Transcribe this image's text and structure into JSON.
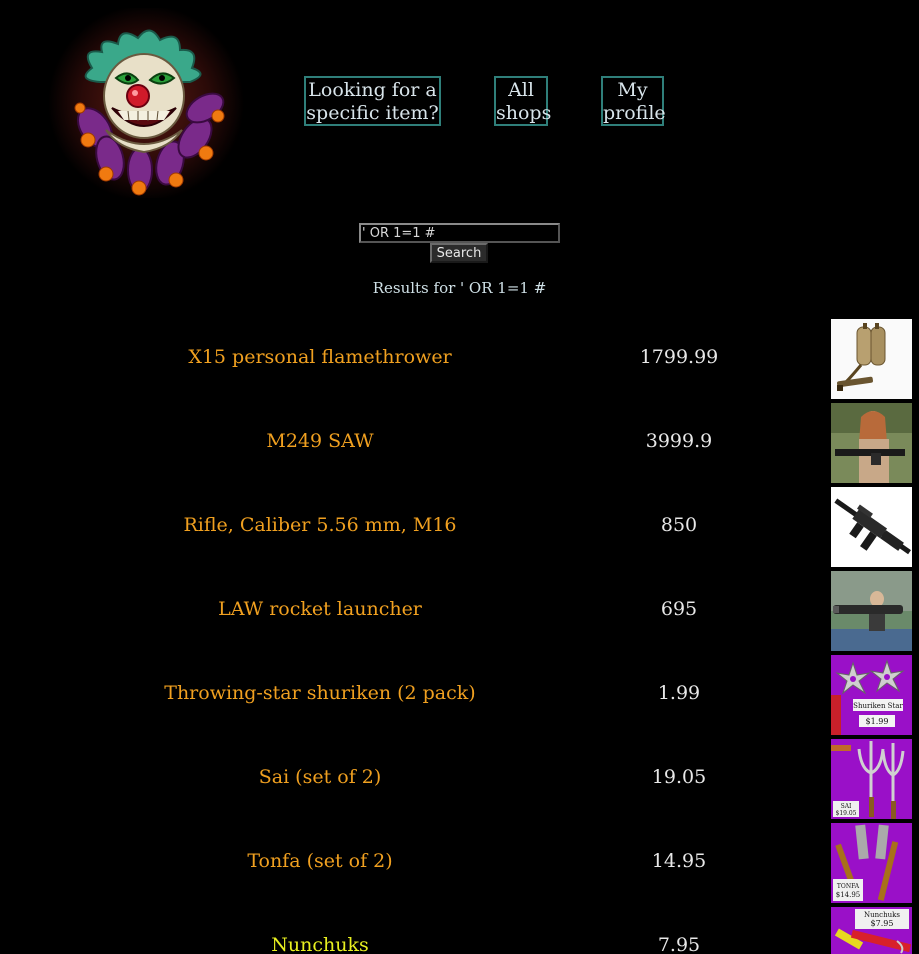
{
  "nav": {
    "find_item_line1": "Looking for a",
    "find_item_line2": "specific item?",
    "all_shops_line1": "All",
    "all_shops_line2": "shops",
    "profile_line1": "My",
    "profile_line2": "profile"
  },
  "search": {
    "value": "' OR 1=1 #",
    "button_label": "Search"
  },
  "results": {
    "heading": "Results for ' OR 1=1 #",
    "items": [
      {
        "name": "X15 personal flamethrower",
        "price": "1799.99",
        "thumb": "flamethrower-image"
      },
      {
        "name": "M249 SAW",
        "price": "3999.9",
        "thumb": "m249-image"
      },
      {
        "name": "Rifle, Caliber 5.56 mm, M16",
        "price": "850",
        "thumb": "m16-rifle-image"
      },
      {
        "name": "LAW rocket launcher",
        "price": "695",
        "thumb": "rocket-launcher-image"
      },
      {
        "name": "Throwing-star shuriken (2 pack)",
        "price": "1.99",
        "thumb": "shuriken-image",
        "thumb_text": "Shuriken Star",
        "thumb_price": "$1.99"
      },
      {
        "name": "Sai (set of 2)",
        "price": "19.05",
        "thumb": "sai-image",
        "thumb_text": "SAI",
        "thumb_price": "$19.05"
      },
      {
        "name": "Tonfa (set of 2)",
        "price": "14.95",
        "thumb": "tonfa-image",
        "thumb_text": "TONFA",
        "thumb_price": "$14.95"
      },
      {
        "name": "Nunchuks",
        "price": "7.95",
        "thumb": "nunchuks-image",
        "thumb_text": "Nunchuks",
        "thumb_price": "$7.95"
      }
    ]
  },
  "colors": {
    "background": "#000000",
    "item_link": "#f0a020",
    "item_link_visited": "#e8f020",
    "nav_border": "#2f7f7a",
    "thumb_purple": "#9a10c8"
  }
}
